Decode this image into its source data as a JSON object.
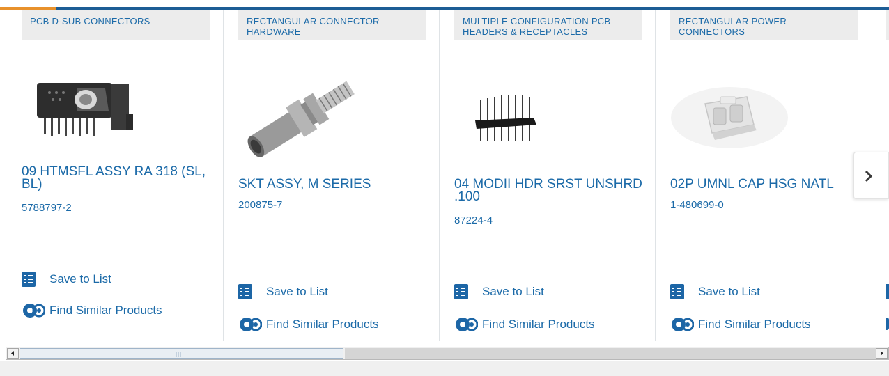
{
  "carousel": {
    "cards": [
      {
        "tag": "PCB D-SUB CONNECTORS",
        "title": "09 HTMSFL ASSY RA 318 (SL, BL)",
        "part": "5788797-2",
        "save_label": "Save to List",
        "similar_label": "Find Similar Products"
      },
      {
        "tag": "RECTANGULAR CONNECTOR HARDWARE",
        "title": "SKT ASSY, M SERIES",
        "part": "200875-7",
        "save_label": "Save to List",
        "similar_label": "Find Similar Products"
      },
      {
        "tag": "MULTIPLE CONFIGURATION PCB HEADERS & RECEPTACLES",
        "title": "04 MODII HDR SRST UNSHRD .100",
        "part": "87224-4",
        "save_label": "Save to List",
        "similar_label": "Find Similar Products"
      },
      {
        "tag": "RECTANGULAR POWER CONNECTORS",
        "title": "02P UMNL CAP HSG NATL",
        "part": "1-480699-0",
        "save_label": "Save to List",
        "similar_label": "Find Similar Products"
      }
    ],
    "next_icon": "chevron-right-icon",
    "colors": {
      "accent": "#1b6aa8",
      "top_bar": "#1d5d95",
      "top_bar_highlight": "#e8912b",
      "tag_bg": "#ececec"
    }
  },
  "scrollbar": {
    "left_icon": "arrow-left-icon",
    "right_icon": "arrow-right-icon",
    "position": 0
  }
}
